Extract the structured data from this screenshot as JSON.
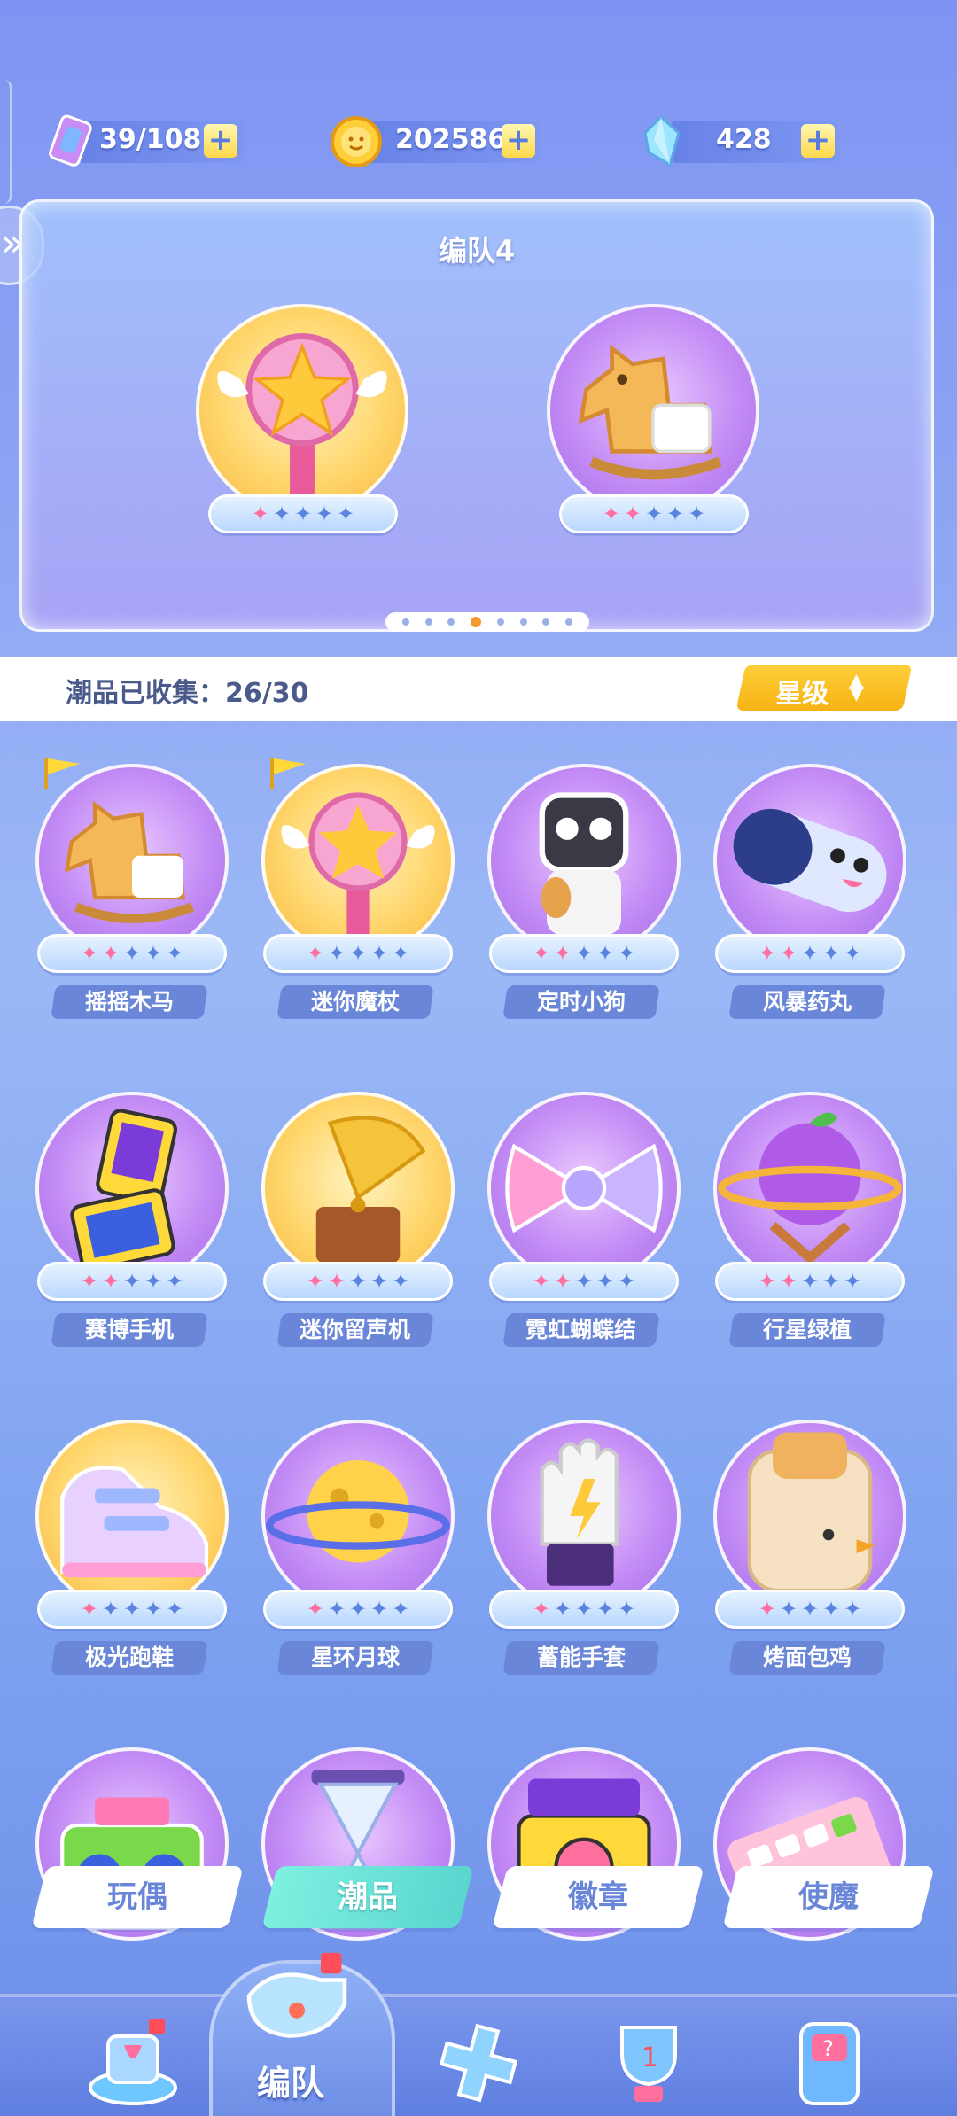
{
  "currencies": {
    "energy": {
      "value": "39/108",
      "icon": "energy-ticket-icon"
    },
    "coin": {
      "value": "202586",
      "icon": "coin-icon"
    },
    "gem": {
      "value": "428",
      "icon": "crystal-icon"
    },
    "plus_label": "+"
  },
  "team": {
    "title": "编队4",
    "slots": [
      {
        "item": "迷你魔杖",
        "stars": 1,
        "max_stars": 5,
        "bg": "gold"
      },
      {
        "item": "摇摇木马",
        "stars": 2,
        "max_stars": 5,
        "bg": "purple"
      }
    ],
    "page_count": 8,
    "active_page": 4
  },
  "collection": {
    "label": "潮品已收集：26/30",
    "sort_label": "星级"
  },
  "items": [
    {
      "name": "摇摇木马",
      "stars": 2,
      "bg": "purple",
      "icon": "rocking-horse-icon",
      "flag": true
    },
    {
      "name": "迷你魔杖",
      "stars": 1,
      "bg": "gold",
      "icon": "magic-wand-icon",
      "flag": true
    },
    {
      "name": "定时小狗",
      "stars": 2,
      "bg": "purple",
      "icon": "robot-dog-icon"
    },
    {
      "name": "风暴药丸",
      "stars": 2,
      "bg": "purple",
      "icon": "pill-icon"
    },
    {
      "name": "赛博手机",
      "stars": 2,
      "bg": "purple",
      "icon": "flip-phone-icon"
    },
    {
      "name": "迷你留声机",
      "stars": 2,
      "bg": "gold",
      "icon": "gramophone-icon"
    },
    {
      "name": "霓虹蝴蝶结",
      "stars": 2,
      "bg": "purple",
      "icon": "bow-icon"
    },
    {
      "name": "行星绿植",
      "stars": 2,
      "bg": "purple",
      "icon": "planet-plant-icon"
    },
    {
      "name": "极光跑鞋",
      "stars": 1,
      "bg": "gold",
      "icon": "sneaker-icon"
    },
    {
      "name": "星环月球",
      "stars": 1,
      "bg": "purple",
      "icon": "ringed-moon-icon"
    },
    {
      "name": "蓄能手套",
      "stars": 1,
      "bg": "purple",
      "icon": "glove-icon"
    },
    {
      "name": "烤面包鸡",
      "stars": 1,
      "bg": "purple",
      "icon": "toaster-chick-icon"
    },
    {
      "name": "",
      "stars": 0,
      "bg": "purple",
      "icon": "boombox-icon"
    },
    {
      "name": "",
      "stars": 0,
      "bg": "purple",
      "icon": "hourglass-icon"
    },
    {
      "name": "",
      "stars": 0,
      "bg": "purple",
      "icon": "camera-icon"
    },
    {
      "name": "",
      "stars": 0,
      "bg": "purple",
      "icon": "keyboard-icon"
    }
  ],
  "category_tabs": [
    {
      "label": "玩偶",
      "active": false
    },
    {
      "label": "潮品",
      "active": true
    },
    {
      "label": "徽章",
      "active": false
    },
    {
      "label": "使魔",
      "active": false
    }
  ],
  "bottom_nav": {
    "active_label": "编队",
    "items": [
      "shop-icon",
      "whistle-icon",
      "gamepad-icon",
      "trophy-icon",
      "slot-machine-icon"
    ]
  },
  "colors": {
    "star_on": "#ff6fa2",
    "star_off": "#5a84de",
    "accent": "#f7b314",
    "tab_active": "#5ad6cf"
  }
}
